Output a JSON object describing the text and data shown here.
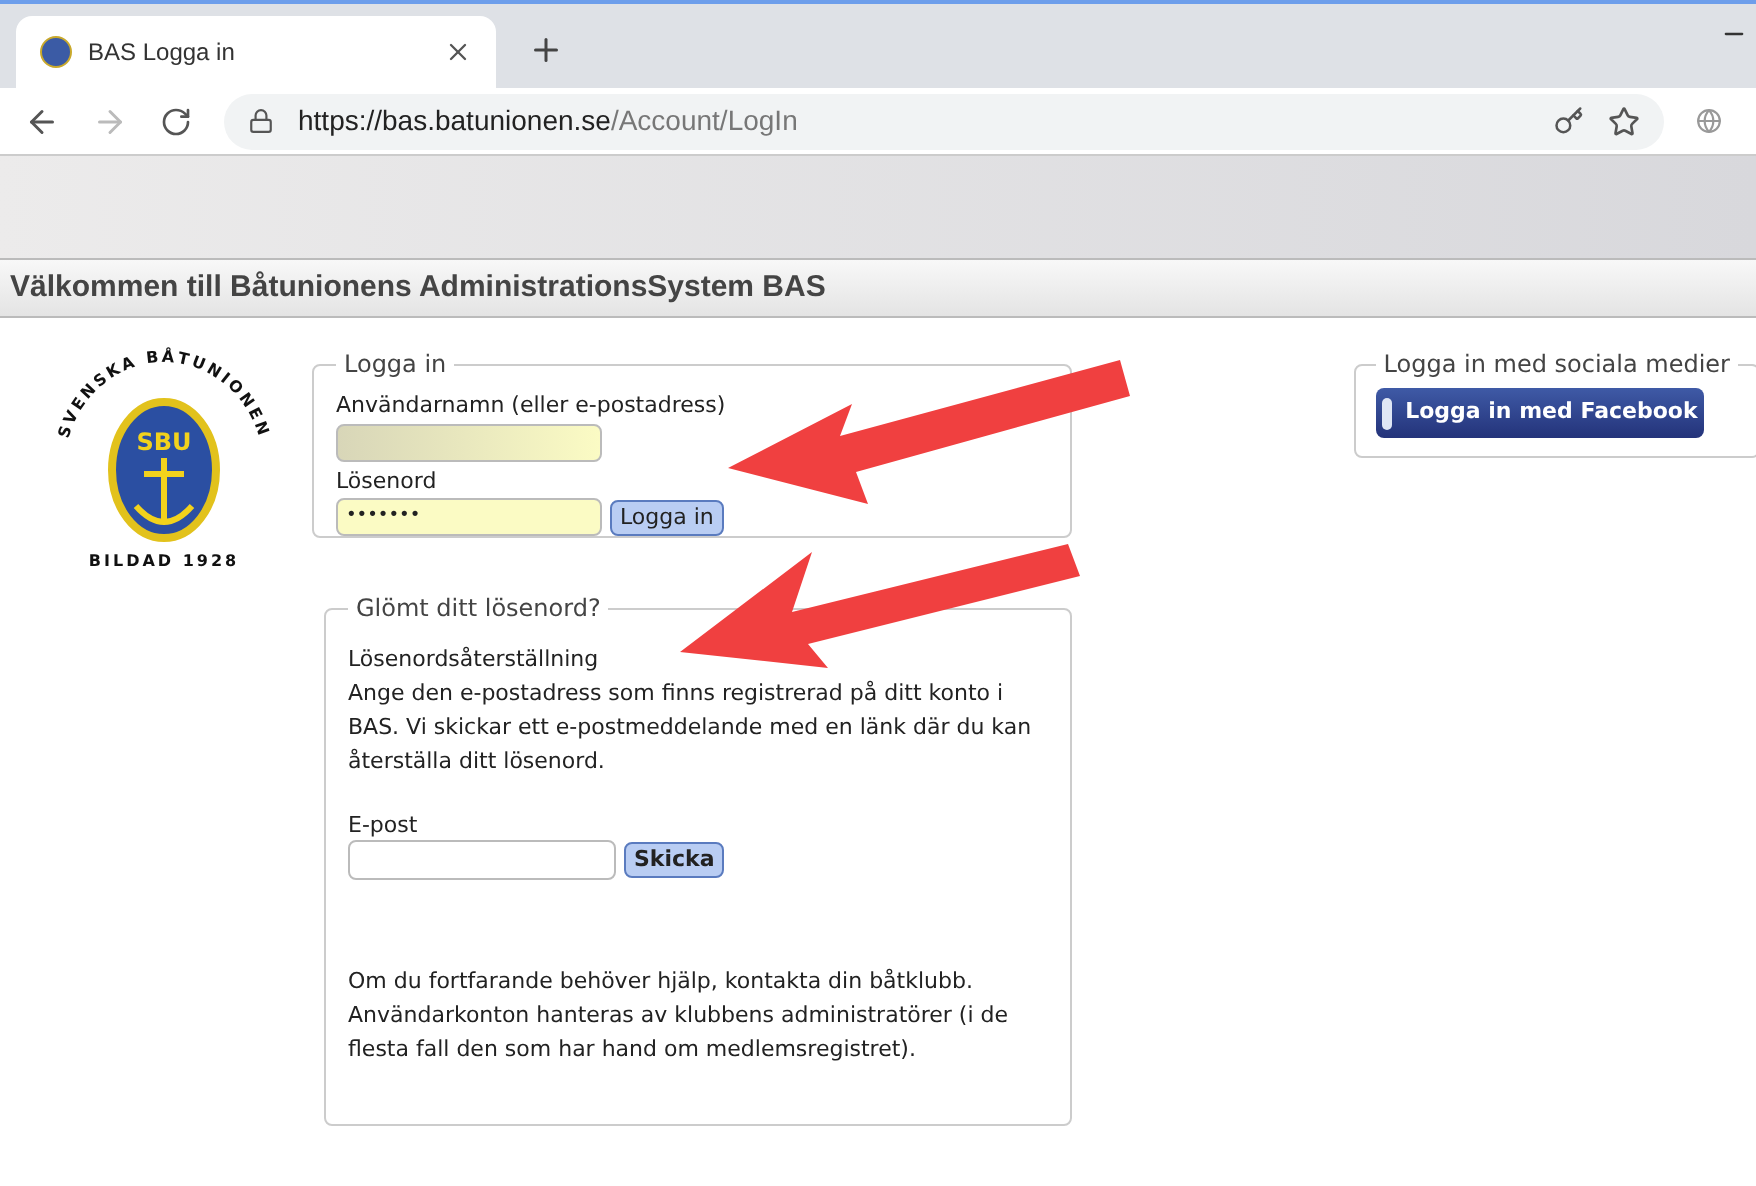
{
  "browser": {
    "tab_title": "BAS Logga in",
    "url_host": "https://bas.batunionen.se",
    "url_path": "/Account/LogIn"
  },
  "page_heading": "Välkommen till Båtunionens AdministrationsSystem BAS",
  "logo": {
    "ring_top": "SVENSKA BÅTUNIONEN",
    "ring_bottom": "BILDAD 1928",
    "center": "SBU"
  },
  "login": {
    "legend": "Logga in",
    "username_label": "Användarnamn (eller e-postadress)",
    "username_blurred": true,
    "password_label": "Lösenord",
    "password_value": "•••••••",
    "button": "Logga in"
  },
  "forgot": {
    "legend": "Glömt ditt lösenord?",
    "title": "Lösenordsåterställning",
    "text": "Ange den e-postadress som finns registrerad på ditt konto i BAS. Vi skickar ett e-postmeddelande med en länk där du kan återställa ditt lösenord.",
    "email_label": "E-post",
    "button": "Skicka",
    "help": "Om du fortfarande behöver hjälp, kontakta din båtklubb.",
    "help_2": "Användarkonton hanteras av klubbens administratörer (i de flesta fall den som har hand om medlemsregistret)."
  },
  "social": {
    "legend": "Logga in med sociala medier",
    "button": "Logga in med Facebook"
  }
}
